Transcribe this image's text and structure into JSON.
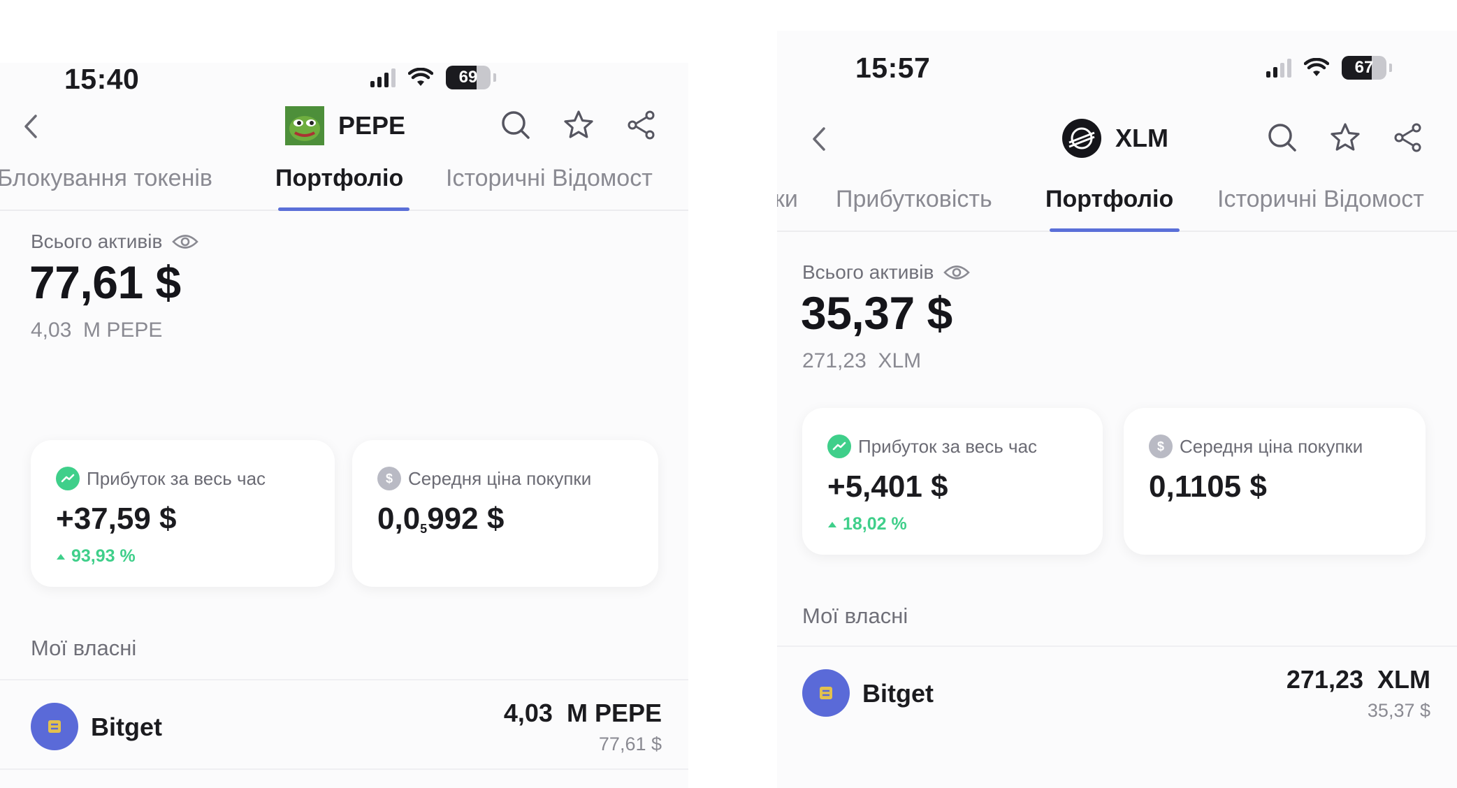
{
  "screens": [
    {
      "status": {
        "time": "15:40",
        "battery": "69",
        "battery_level": 0.69,
        "signal_bars": 4
      },
      "coin": {
        "symbol": "PEPE",
        "icon": "pepe-frog-icon"
      },
      "tabs": [
        "Блокування токенів",
        "Портфоліо",
        "Історичні Відомост"
      ],
      "active_tab": "Портфоліо",
      "total": {
        "label": "Всього активів",
        "value": "77,61 $",
        "amount": "4,03  M PEPE"
      },
      "cards": {
        "profit": {
          "label": "Прибуток за весь час",
          "value": "+37,59 $",
          "change": "93,93 %"
        },
        "avg_price": {
          "label": "Середня ціна покупки",
          "value_main": "0,0",
          "value_sub": "5",
          "value_tail": "992 $"
        }
      },
      "holdings": {
        "title": "Мої власні",
        "items": [
          {
            "exchange": "Bitget",
            "amount": "4,03  M PEPE",
            "usd": "77,61 $"
          }
        ]
      }
    },
    {
      "status": {
        "time": "15:57",
        "battery": "67",
        "battery_level": 0.67,
        "signal_bars": 2
      },
      "coin": {
        "symbol": "XLM",
        "icon": "stellar-logo-icon"
      },
      "tabs": [
        "ки",
        "Прибутковість",
        "Портфоліо",
        "Історичні Відомост"
      ],
      "active_tab": "Портфоліо",
      "total": {
        "label": "Всього активів",
        "value": "35,37 $",
        "amount": "271,23  XLM"
      },
      "cards": {
        "profit": {
          "label": "Прибуток за весь час",
          "value": "+5,401 $",
          "change": "18,02 %"
        },
        "avg_price": {
          "label": "Середня ціна покупки",
          "value": "0,1105 $"
        }
      },
      "holdings": {
        "title": "Мої власні",
        "items": [
          {
            "exchange": "Bitget",
            "amount": "271,23  XLM",
            "usd": "35,37 $"
          }
        ]
      }
    }
  ],
  "colors": {
    "accent_underline": "#5a6fd8",
    "profit_green": "#3fcf8a",
    "exchange_logo": "#5a6ad8",
    "muted_text": "#8a8a92"
  }
}
